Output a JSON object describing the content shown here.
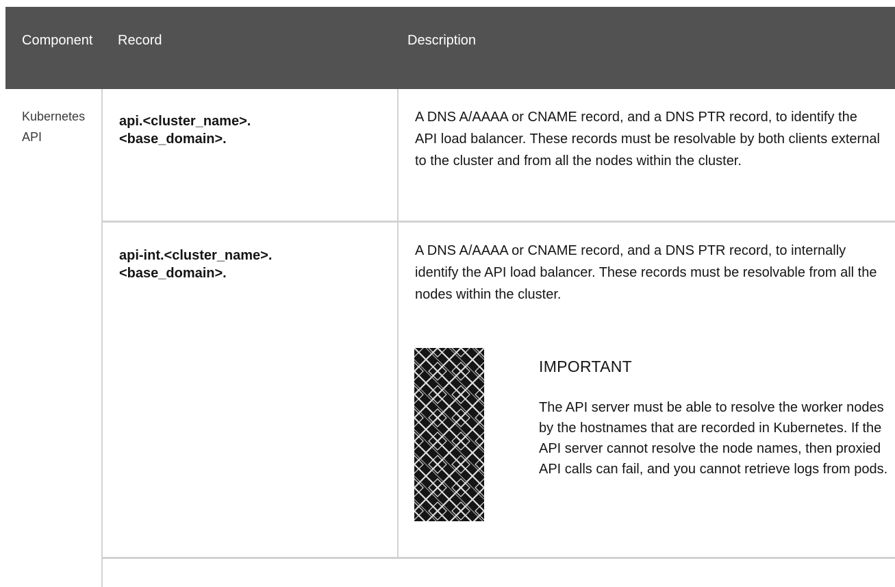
{
  "table": {
    "headers": {
      "component": "Component",
      "record": "Record",
      "description": "Description"
    },
    "component_cell": "Kubernetes API",
    "rows": [
      {
        "record_line1": "api.<cluster_name>.",
        "record_line2": "<base_domain>.",
        "description": "A DNS A/AAAA or CNAME record, and a DNS PTR record, to identify the API load balancer. These records must be resolvable by both clients external to the cluster and from all the nodes within the cluster."
      },
      {
        "record_line1": "api-int.<cluster_name>.",
        "record_line2": "<base_domain>.",
        "description": "A DNS A/AAAA or CNAME record, and a DNS PTR record, to internally identify the API load balancer. These records must be resolvable from all the nodes within the cluster.",
        "admonition": {
          "title": "IMPORTANT",
          "icon": "important-pattern-icon",
          "body": "The API server must be able to resolve the worker nodes by the hostnames that are recorded in Kubernetes. If the API server cannot resolve the node names, then proxied API calls can fail, and you cannot retrieve logs from pods."
        }
      }
    ]
  },
  "colors": {
    "header_bg": "#525252",
    "header_text": "#ffffff",
    "border": "#d2d2d2",
    "text": "#151515",
    "icon_bg": "#151515",
    "icon_pattern": "#e0e0e0"
  }
}
